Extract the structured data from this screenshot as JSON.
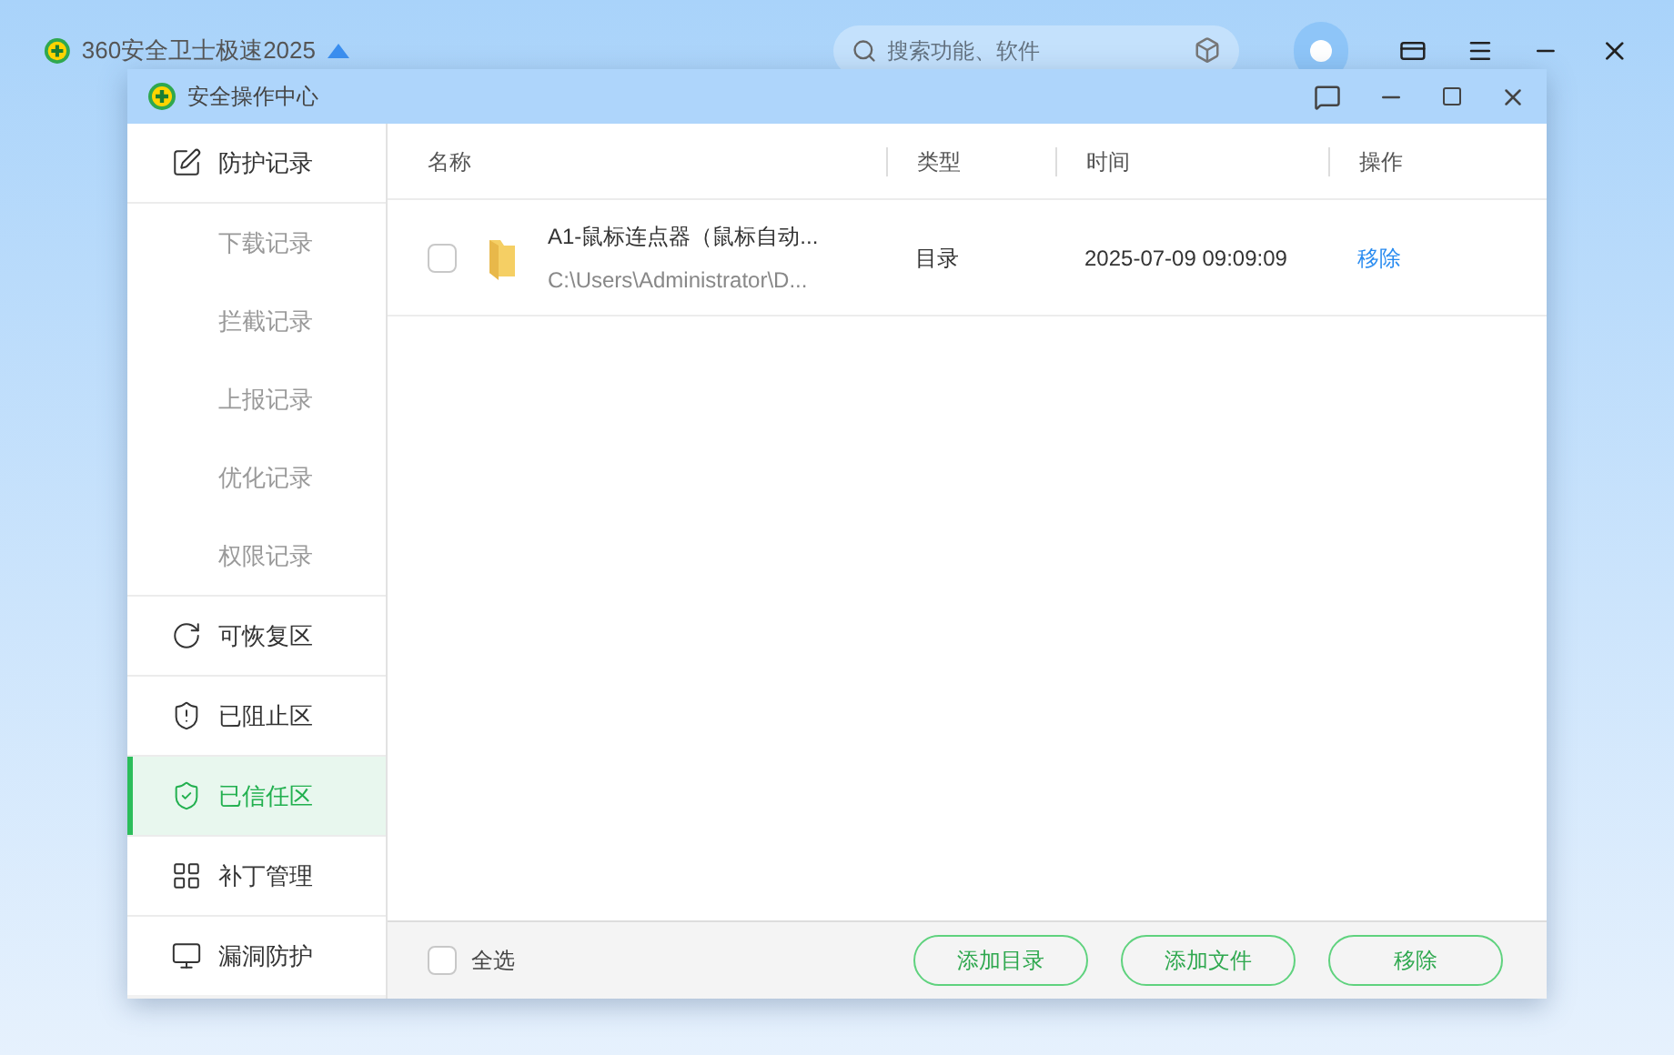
{
  "app": {
    "title": "360安全卫士极速2025",
    "search": {
      "placeholder": "搜索功能、软件"
    }
  },
  "window": {
    "title": "安全操作中心"
  },
  "sidebar": {
    "items": [
      {
        "label": "防护记录",
        "selected": false,
        "children": [
          {
            "label": "下载记录",
            "selected": false
          },
          {
            "label": "拦截记录",
            "selected": false
          },
          {
            "label": "上报记录",
            "selected": false
          },
          {
            "label": "优化记录",
            "selected": false
          },
          {
            "label": "权限记录",
            "selected": false
          }
        ]
      },
      {
        "label": "可恢复区",
        "selected": false
      },
      {
        "label": "已阻止区",
        "selected": false
      },
      {
        "label": "已信任区",
        "selected": true
      },
      {
        "label": "补丁管理",
        "selected": false
      },
      {
        "label": "漏洞防护",
        "selected": false
      }
    ]
  },
  "table": {
    "columns": [
      "名称",
      "类型",
      "时间",
      "操作"
    ],
    "rows": [
      {
        "checked": false,
        "name": "A1-鼠标连点器（鼠标自动...",
        "path": "C:\\Users\\Administrator\\D...",
        "type": "目录",
        "time": "2025-07-09 09:09:09",
        "action": "移除"
      }
    ]
  },
  "footer": {
    "select_all": {
      "label": "全选",
      "checked": false
    },
    "buttons": [
      "添加目录",
      "添加文件",
      "移除"
    ]
  }
}
